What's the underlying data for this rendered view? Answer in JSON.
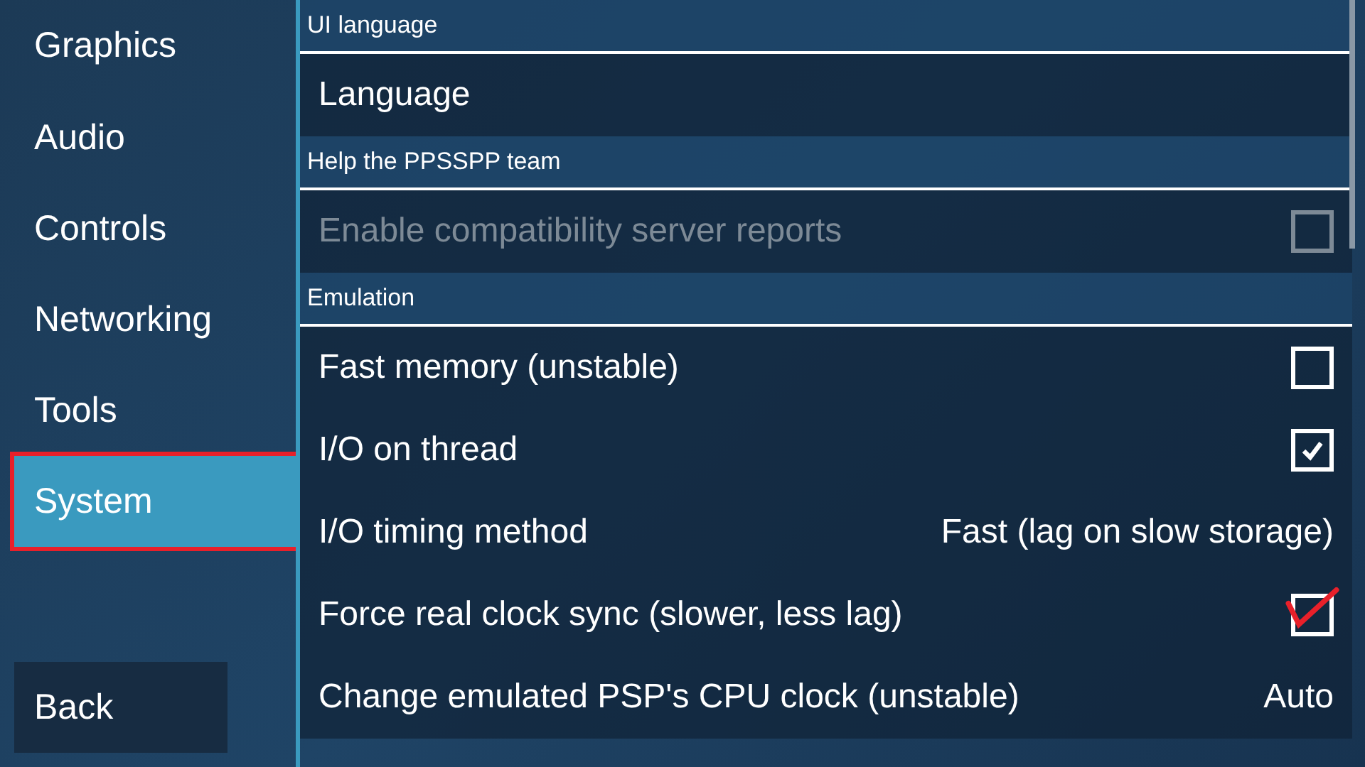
{
  "sidebar": {
    "items": [
      {
        "label": "Graphics",
        "selected": false,
        "highlighted": false
      },
      {
        "label": "Audio",
        "selected": false,
        "highlighted": false
      },
      {
        "label": "Controls",
        "selected": false,
        "highlighted": false
      },
      {
        "label": "Networking",
        "selected": false,
        "highlighted": false
      },
      {
        "label": "Tools",
        "selected": false,
        "highlighted": false
      },
      {
        "label": "System",
        "selected": true,
        "highlighted": true
      }
    ],
    "back_button": "Back"
  },
  "settings": {
    "items": [
      {
        "kind": "header",
        "label": "UI language"
      },
      {
        "kind": "choice",
        "label": "Language",
        "disabled": false
      },
      {
        "kind": "header",
        "label": "Help the PPSSPP team"
      },
      {
        "kind": "checkbox",
        "label": "Enable compatibility server reports",
        "disabled": true,
        "checked": false
      },
      {
        "kind": "header",
        "label": "Emulation"
      },
      {
        "kind": "checkbox",
        "label": "Fast memory (unstable)",
        "disabled": false,
        "checked": false
      },
      {
        "kind": "checkbox",
        "label": "I/O on thread",
        "disabled": false,
        "checked": true
      },
      {
        "kind": "choice",
        "label": "I/O timing method",
        "value": "Fast (lag on slow storage)",
        "disabled": false
      },
      {
        "kind": "checkbox",
        "label": "Force real clock sync (slower, less lag)",
        "disabled": false,
        "checked": true,
        "annotated": true
      },
      {
        "kind": "choice",
        "label": "Change emulated PSP's CPU clock (unstable)",
        "value": "Auto",
        "disabled": false
      }
    ]
  }
}
